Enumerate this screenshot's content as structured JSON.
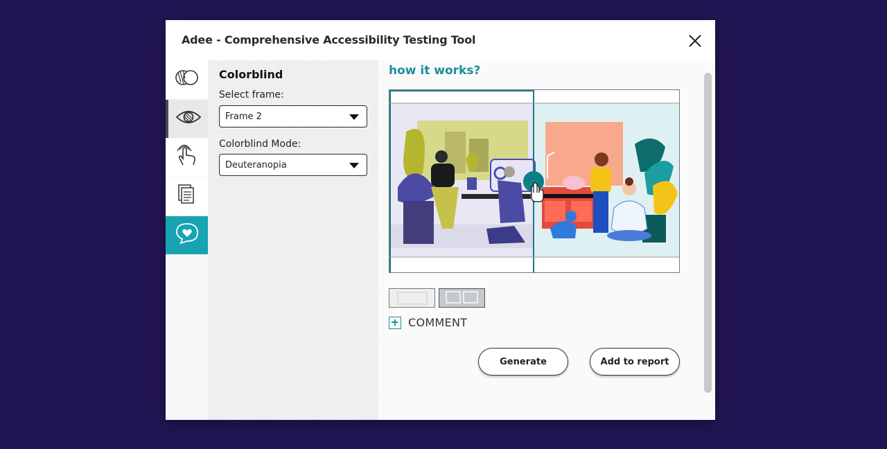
{
  "window": {
    "title": "Adee - Comprehensive Accessibility Testing Tool"
  },
  "sidebar": {
    "tabs": [
      {
        "icon": "overlap-circles-icon",
        "active": false
      },
      {
        "icon": "eye-icon",
        "active": true
      },
      {
        "icon": "touch-hand-icon",
        "active": false
      },
      {
        "icon": "documents-icon",
        "active": false
      },
      {
        "icon": "heart-chat-icon",
        "active": false
      }
    ]
  },
  "panel": {
    "title": "Colorblind",
    "frame_label": "Select frame:",
    "frame_value": "Frame 2",
    "mode_label": "Colorblind Mode:",
    "mode_value": "Deuteranopia"
  },
  "main": {
    "heading": "how it works?",
    "comment_label": "COMMENT",
    "generate_label": "Generate",
    "add_report_label": "Add to report"
  },
  "colors": {
    "accent": "#17a3b2",
    "heading": "#1b8f9a",
    "background": "#221553"
  }
}
